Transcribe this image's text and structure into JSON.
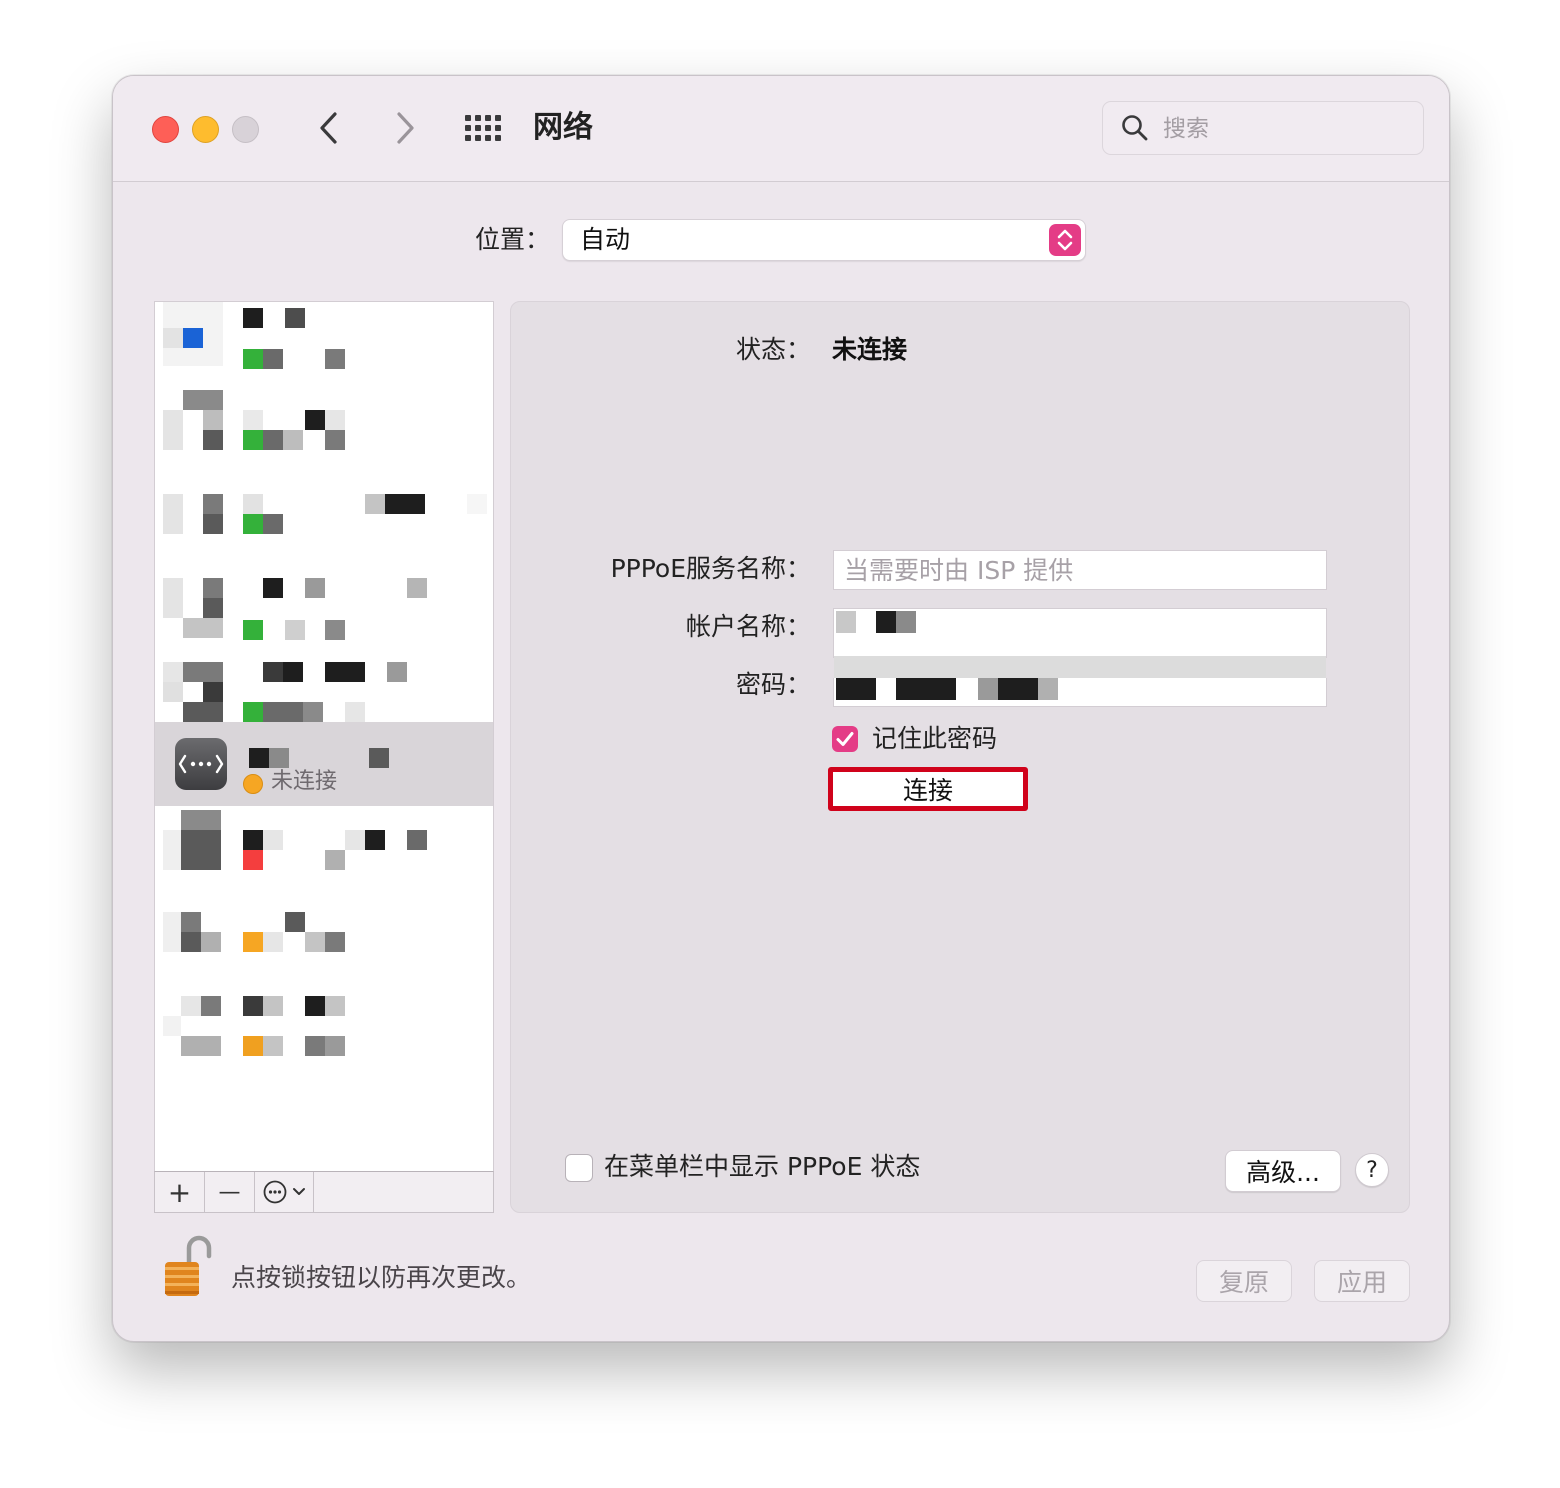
{
  "window": {
    "title": "网络",
    "search_placeholder": "搜索"
  },
  "location": {
    "label": "位置：",
    "value": "自动"
  },
  "sidebar": {
    "selected_service": {
      "status": "未连接",
      "status_color": "#f6a623"
    },
    "toolbar": {
      "add": "+",
      "remove": "—"
    }
  },
  "detail": {
    "status_label": "状态：",
    "status_value": "未连接",
    "pppoe_service_label": "PPPoE服务名称：",
    "pppoe_service_placeholder": "当需要时由 ISP 提供",
    "account_label": "帐户名称：",
    "password_label": "密码：",
    "remember_password_label": "记住此密码",
    "remember_password_checked": true,
    "connect_button": "连接",
    "show_in_menubar_label": "在菜单栏中显示 PPPoE 状态",
    "show_in_menubar_checked": false,
    "advanced_button": "高级...",
    "help_button": "?"
  },
  "footer": {
    "lock_text": "点按锁按钮以防再次更改。",
    "revert_button": "复原",
    "apply_button": "应用"
  },
  "colors": {
    "accent": "#e43c86",
    "highlight_border": "#d0021b"
  }
}
